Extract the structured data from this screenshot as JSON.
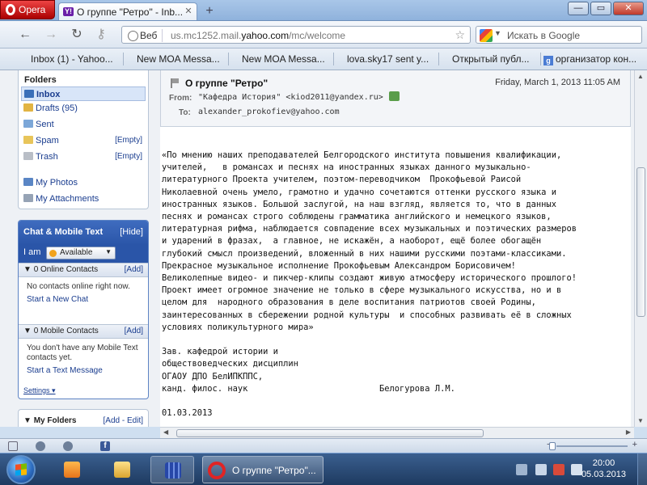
{
  "browser": {
    "menu_label": "Opera",
    "tab_title": "О группе \"Ретро\" - Inb...",
    "tab_favicon": "Y!",
    "address": {
      "mode_label": "Веб",
      "url_prefix": "us.mc1252.mail.",
      "url_domain": "yahoo.com",
      "url_path": "/mc/welcome"
    },
    "search_placeholder": "Искать в Google",
    "bookmarks": [
      "Inbox (1) - Yahoo...",
      "New MOA Messa...",
      "New MOA Messa...",
      "lova.sky17 sent y...",
      "Открытый публ...",
      "организатор кон..."
    ]
  },
  "sidebar": {
    "folders_title": "Folders",
    "folders": [
      {
        "label": "Inbox"
      },
      {
        "label": "Drafts (95)"
      },
      {
        "label": "Sent"
      },
      {
        "label": "Spam",
        "action": "[Empty]"
      },
      {
        "label": "Trash",
        "action": "[Empty]"
      }
    ],
    "extras": [
      "My Photos",
      "My Attachments"
    ],
    "chat": {
      "title": "Chat & Mobile Text",
      "hide": "[Hide]",
      "iam": "I am",
      "status": "Available",
      "online_section": "0 Online Contacts",
      "online_add": "[Add]",
      "online_empty": "No contacts online right now.",
      "online_link": "Start a New Chat",
      "mobile_section": "0 Mobile Contacts",
      "mobile_add": "[Add]",
      "mobile_empty": "You don't have any Mobile Text contacts yet.",
      "mobile_link": "Start a Text Message",
      "settings": "Settings"
    },
    "my_folders": "My Folders",
    "my_folders_actions": "[Add - Edit]"
  },
  "message": {
    "subject": "О группе \"Ретро\"",
    "date": "Friday, March 1, 2013 11:05 AM",
    "from_label": "From:",
    "from_value": "\"Кафедра История\" <kiod2011@yandex.ru>",
    "to_label": "To:",
    "to_value": "alexander_prokofiev@yahoo.com",
    "body_lines": [
      "«По мнению наших преподавателей Белгородского института повышения квалификации,",
      "учителей,   в романсах и песнях на иностранных языках данного музыкально-",
      "литературного Проекта учителем, поэтом-переводчиком  Прокофьевой Раисой",
      "Николаевной очень умело, грамотно и удачно сочетаются оттенки русского языка и",
      "иностранных языков. Большой заслугой, на наш взгляд, является то, что в данных",
      "песнях и романсах строго соблюдены грамматика английского и немецкого языков,",
      "литературная рифма, наблюдается совпадение всех музыкальных и поэтических размеров",
      "и ударений в фразах,  а главное, не искажён, а наоборот, ещё более обогащён",
      "глубокий смысл произведений, вложенный в них нашими русскими поэтами-классиками.",
      "Прекрасное музыкальное исполнение Прокофьевым Александром Борисовичем!",
      "Великолепные видео- и пикчер-клипы создают живую атмосферу исторического прошлого!",
      "Проект имеет огромное значение не только в сфере музыкального искусства, но и в",
      "целом для  народного образования в деле воспитания патриотов своей Родины,",
      "заинтересованных в сбережении родной культуры  и способных развивать её в сложных",
      "условиях поликультурного мира»",
      "",
      "Зав. кафедрой истории и",
      "обществоведческих дисциплин",
      "ОГАОУ ДПО БелИПКППС,",
      "канд. филос. наук                          Белогурова Л.М.",
      "",
      "01.03.2013"
    ]
  },
  "taskbar": {
    "active_window": "О группе \"Ретро\"...",
    "time": "20:00",
    "date": "05.03.2013"
  }
}
